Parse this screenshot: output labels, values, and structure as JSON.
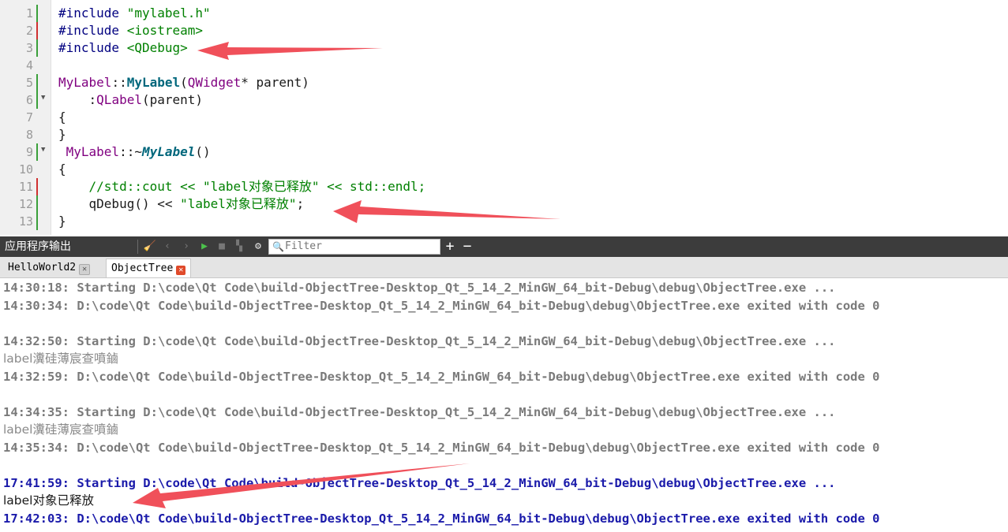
{
  "editor": {
    "lines": [
      {
        "num": "1",
        "marker": "green",
        "fold": "",
        "parts": [
          [
            "#include ",
            "c-pre"
          ],
          [
            "\"mylabel.h\"",
            "c-str"
          ]
        ]
      },
      {
        "num": "2",
        "marker": "red",
        "fold": "",
        "parts": [
          [
            "#include ",
            "c-pre"
          ],
          [
            "<iostream>",
            "c-str"
          ]
        ]
      },
      {
        "num": "3",
        "marker": "green",
        "fold": "",
        "parts": [
          [
            "#include ",
            "c-pre"
          ],
          [
            "<QDebug>",
            "c-str"
          ]
        ]
      },
      {
        "num": "4",
        "marker": "",
        "fold": "",
        "parts": []
      },
      {
        "num": "5",
        "marker": "green",
        "fold": "",
        "parts": [
          [
            "MyLabel",
            "c-cls"
          ],
          [
            "::",
            "c-op"
          ],
          [
            "MyLabel",
            "c-func"
          ],
          [
            "(",
            "c-op"
          ],
          [
            "QWidget",
            "c-cls"
          ],
          [
            "* parent)",
            "c-op"
          ]
        ]
      },
      {
        "num": "6",
        "marker": "green",
        "fold": "▼",
        "parts": [
          [
            "    :",
            "c-op"
          ],
          [
            "QLabel",
            "c-cls"
          ],
          [
            "(parent)",
            "c-op"
          ]
        ]
      },
      {
        "num": "7",
        "marker": "",
        "fold": "",
        "parts": [
          [
            "{",
            "c-op"
          ]
        ]
      },
      {
        "num": "8",
        "marker": "",
        "fold": "",
        "parts": [
          [
            "}",
            "c-op"
          ]
        ]
      },
      {
        "num": "9",
        "marker": "green",
        "fold": "▼",
        "parts": [
          [
            " MyLabel",
            "c-cls"
          ],
          [
            "::~",
            "c-op"
          ],
          [
            "MyLabel",
            "c-func c-ital"
          ],
          [
            "()",
            "c-op"
          ]
        ]
      },
      {
        "num": "10",
        "marker": "",
        "fold": "",
        "parts": [
          [
            "{",
            "c-op"
          ]
        ]
      },
      {
        "num": "11",
        "marker": "red",
        "fold": "",
        "parts": [
          [
            "    //std::cout << \"label对象已释放\" << std::endl;",
            "c-com"
          ]
        ]
      },
      {
        "num": "12",
        "marker": "green",
        "fold": "",
        "parts": [
          [
            "    qDebug() << ",
            "c-op"
          ],
          [
            "\"label对象已释放\"",
            "c-str"
          ],
          [
            ";",
            "c-op"
          ]
        ]
      },
      {
        "num": "13",
        "marker": "green",
        "fold": "",
        "parts": [
          [
            "}",
            "c-op"
          ]
        ]
      }
    ]
  },
  "output_pane": {
    "title": "应用程序输出",
    "filter_placeholder": "Filter",
    "tabs": [
      {
        "label": "HelloWorld2",
        "active": false
      },
      {
        "label": "ObjectTree",
        "active": true
      }
    ],
    "log": [
      {
        "text": "14:30:18: Starting D:\\code\\Qt Code\\build-ObjectTree-Desktop_Qt_5_14_2_MinGW_64_bit-Debug\\debug\\ObjectTree.exe ...",
        "style": "old"
      },
      {
        "text": "14:30:34: D:\\code\\Qt Code\\build-ObjectTree-Desktop_Qt_5_14_2_MinGW_64_bit-Debug\\debug\\ObjectTree.exe exited with code 0",
        "style": "old"
      },
      {
        "text": "",
        "style": "old"
      },
      {
        "text": "14:32:50: Starting D:\\code\\Qt Code\\build-ObjectTree-Desktop_Qt_5_14_2_MinGW_64_bit-Debug\\debug\\ObjectTree.exe ...",
        "style": "old"
      },
      {
        "text": "label瀵硅薄宸查噴鏀",
        "style": "plain old"
      },
      {
        "text": "14:32:59: D:\\code\\Qt Code\\build-ObjectTree-Desktop_Qt_5_14_2_MinGW_64_bit-Debug\\debug\\ObjectTree.exe exited with code 0",
        "style": "old"
      },
      {
        "text": "",
        "style": "old"
      },
      {
        "text": "14:34:35: Starting D:\\code\\Qt Code\\build-ObjectTree-Desktop_Qt_5_14_2_MinGW_64_bit-Debug\\debug\\ObjectTree.exe ...",
        "style": "old"
      },
      {
        "text": "label瀵硅薄宸查噴鏀",
        "style": "plain old"
      },
      {
        "text": "14:35:34: D:\\code\\Qt Code\\build-ObjectTree-Desktop_Qt_5_14_2_MinGW_64_bit-Debug\\debug\\ObjectTree.exe exited with code 0",
        "style": "old"
      },
      {
        "text": "",
        "style": "old"
      },
      {
        "text": "17:41:59: Starting D:\\code\\Qt Code\\build-ObjectTree-Desktop_Qt_5_14_2_MinGW_64_bit-Debug\\debug\\ObjectTree.exe ...",
        "style": "new"
      },
      {
        "text": "label对象已释放",
        "style": "plain new"
      },
      {
        "text": "17:42:03: D:\\code\\Qt Code\\build-ObjectTree-Desktop_Qt_5_14_2_MinGW_64_bit-Debug\\debug\\ObjectTree.exe exited with code 0",
        "style": "new"
      }
    ]
  },
  "colors": {
    "annotation_arrow": "#f0505a",
    "toolbar_bg": "#3c3c3c",
    "log_new": "#1a1aaa",
    "log_old": "#7a7a7a"
  }
}
